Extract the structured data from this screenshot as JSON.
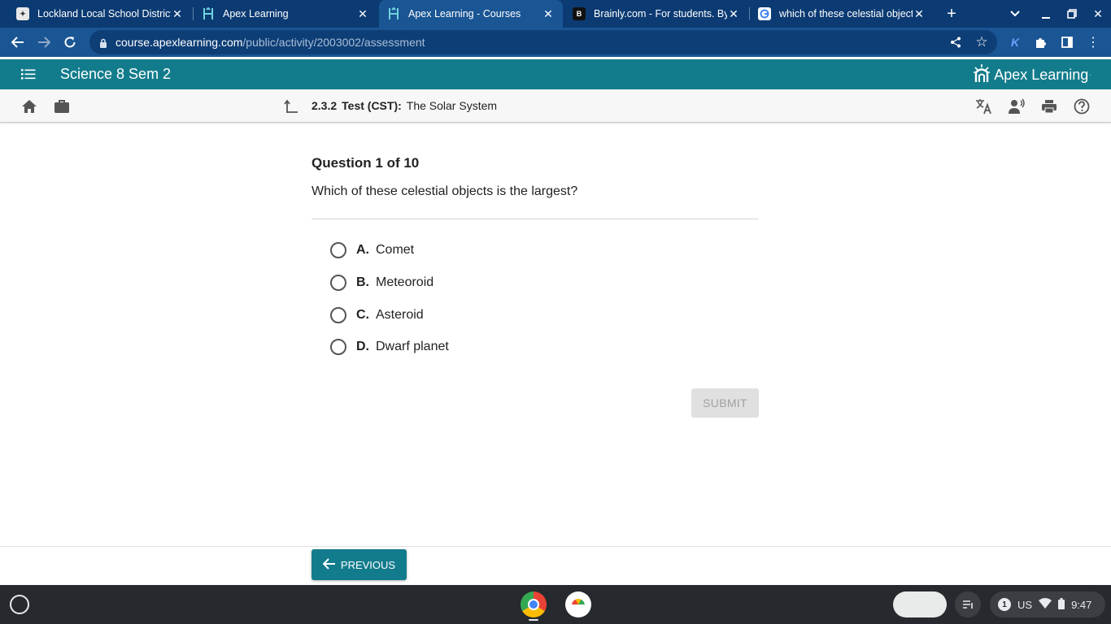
{
  "browser": {
    "tabs": [
      {
        "title": "Lockland Local School District",
        "active": false
      },
      {
        "title": "Apex Learning",
        "active": false
      },
      {
        "title": "Apex Learning - Courses",
        "active": true
      },
      {
        "title": "Brainly.com - For students. By",
        "active": false
      },
      {
        "title": "which of these celestial object",
        "active": false
      }
    ],
    "url_host": "course.apexlearning.com",
    "url_path": "/public/activity/2003002/assessment",
    "profile_initial": "K"
  },
  "header": {
    "course_title": "Science 8 Sem 2",
    "logo_text": "Apex Learning",
    "logo_mark": "·"
  },
  "activity": {
    "number": "2.3.2",
    "kind": "Test (CST):",
    "title": "The Solar System"
  },
  "question": {
    "counter": "Question 1 of 10",
    "text": "Which of these celestial objects is the largest?",
    "choices": [
      {
        "letter": "A.",
        "text": "Comet"
      },
      {
        "letter": "B.",
        "text": "Meteoroid"
      },
      {
        "letter": "C.",
        "text": "Asteroid"
      },
      {
        "letter": "D.",
        "text": "Dwarf planet"
      }
    ],
    "submit_label": "SUBMIT"
  },
  "nav": {
    "previous_label": "PREVIOUS"
  },
  "shelf": {
    "notification_count": "1",
    "input_method": "US",
    "time": "9:47"
  },
  "colors": {
    "tab_strip": "#0c3b73",
    "toolbar": "#1a5594",
    "apex_teal": "#137c8c",
    "shelf": "#262a2e"
  }
}
